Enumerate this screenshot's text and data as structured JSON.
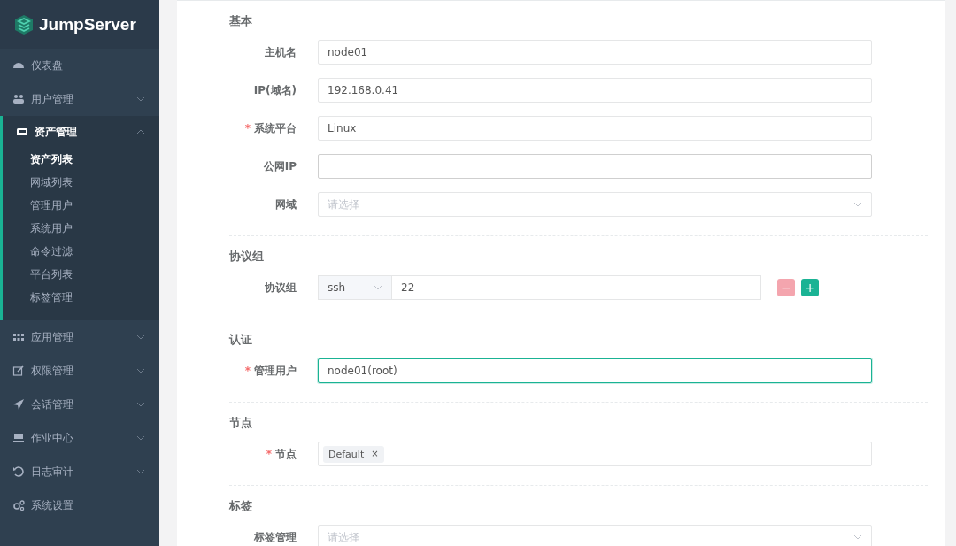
{
  "sidebar": {
    "logo": "JumpServer",
    "items": [
      {
        "label": "仪表盘",
        "kind": "link"
      },
      {
        "label": "用户管理",
        "kind": "group",
        "expanded": false
      },
      {
        "label": "资产管理",
        "kind": "group",
        "expanded": true,
        "children": [
          {
            "label": "资产列表",
            "selected": true
          },
          {
            "label": "网域列表",
            "selected": false
          },
          {
            "label": "管理用户",
            "selected": false
          },
          {
            "label": "系统用户",
            "selected": false
          },
          {
            "label": "命令过滤",
            "selected": false
          },
          {
            "label": "平台列表",
            "selected": false
          },
          {
            "label": "标签管理",
            "selected": false
          }
        ]
      },
      {
        "label": "应用管理",
        "kind": "group",
        "expanded": false
      },
      {
        "label": "权限管理",
        "kind": "group",
        "expanded": false
      },
      {
        "label": "会话管理",
        "kind": "group",
        "expanded": false
      },
      {
        "label": "作业中心",
        "kind": "group",
        "expanded": false
      },
      {
        "label": "日志审计",
        "kind": "group",
        "expanded": false
      },
      {
        "label": "系统设置",
        "kind": "link"
      }
    ]
  },
  "form": {
    "sections": [
      {
        "title": "基本",
        "fields": [
          {
            "label": "主机名",
            "kind": "text",
            "focused": false,
            "value": "node01"
          },
          {
            "label": "IP(域名)",
            "kind": "text",
            "focused": false,
            "value": "192.168.0.41"
          },
          {
            "label": "系统平台",
            "kind": "text",
            "required_mark": "*",
            "focused": false,
            "value": "Linux"
          },
          {
            "label": "公网IP",
            "kind": "text",
            "focused": false
          },
          {
            "label": "网域",
            "kind": "select",
            "focused": false,
            "placeholder": "请选择"
          }
        ]
      },
      {
        "title": "协议组",
        "fields": [
          {
            "label": "协议组",
            "kind": "protocol",
            "focused": false,
            "protocol": "ssh",
            "port": "22",
            "remove": "−",
            "add": "+"
          }
        ]
      },
      {
        "title": "认证",
        "fields": [
          {
            "label": "管理用户",
            "kind": "text",
            "required_mark": "*",
            "focused": true,
            "value": "node01(root)"
          }
        ]
      },
      {
        "title": "节点",
        "fields": [
          {
            "label": "节点",
            "kind": "tags",
            "required_mark": "*",
            "focused": false,
            "tags": [
              {
                "label": "Default",
                "remove": "×"
              }
            ]
          }
        ]
      },
      {
        "title": "标签",
        "fields": [
          {
            "label": "标签管理",
            "kind": "select",
            "focused": false,
            "placeholder": "请选择"
          }
        ]
      }
    ]
  }
}
